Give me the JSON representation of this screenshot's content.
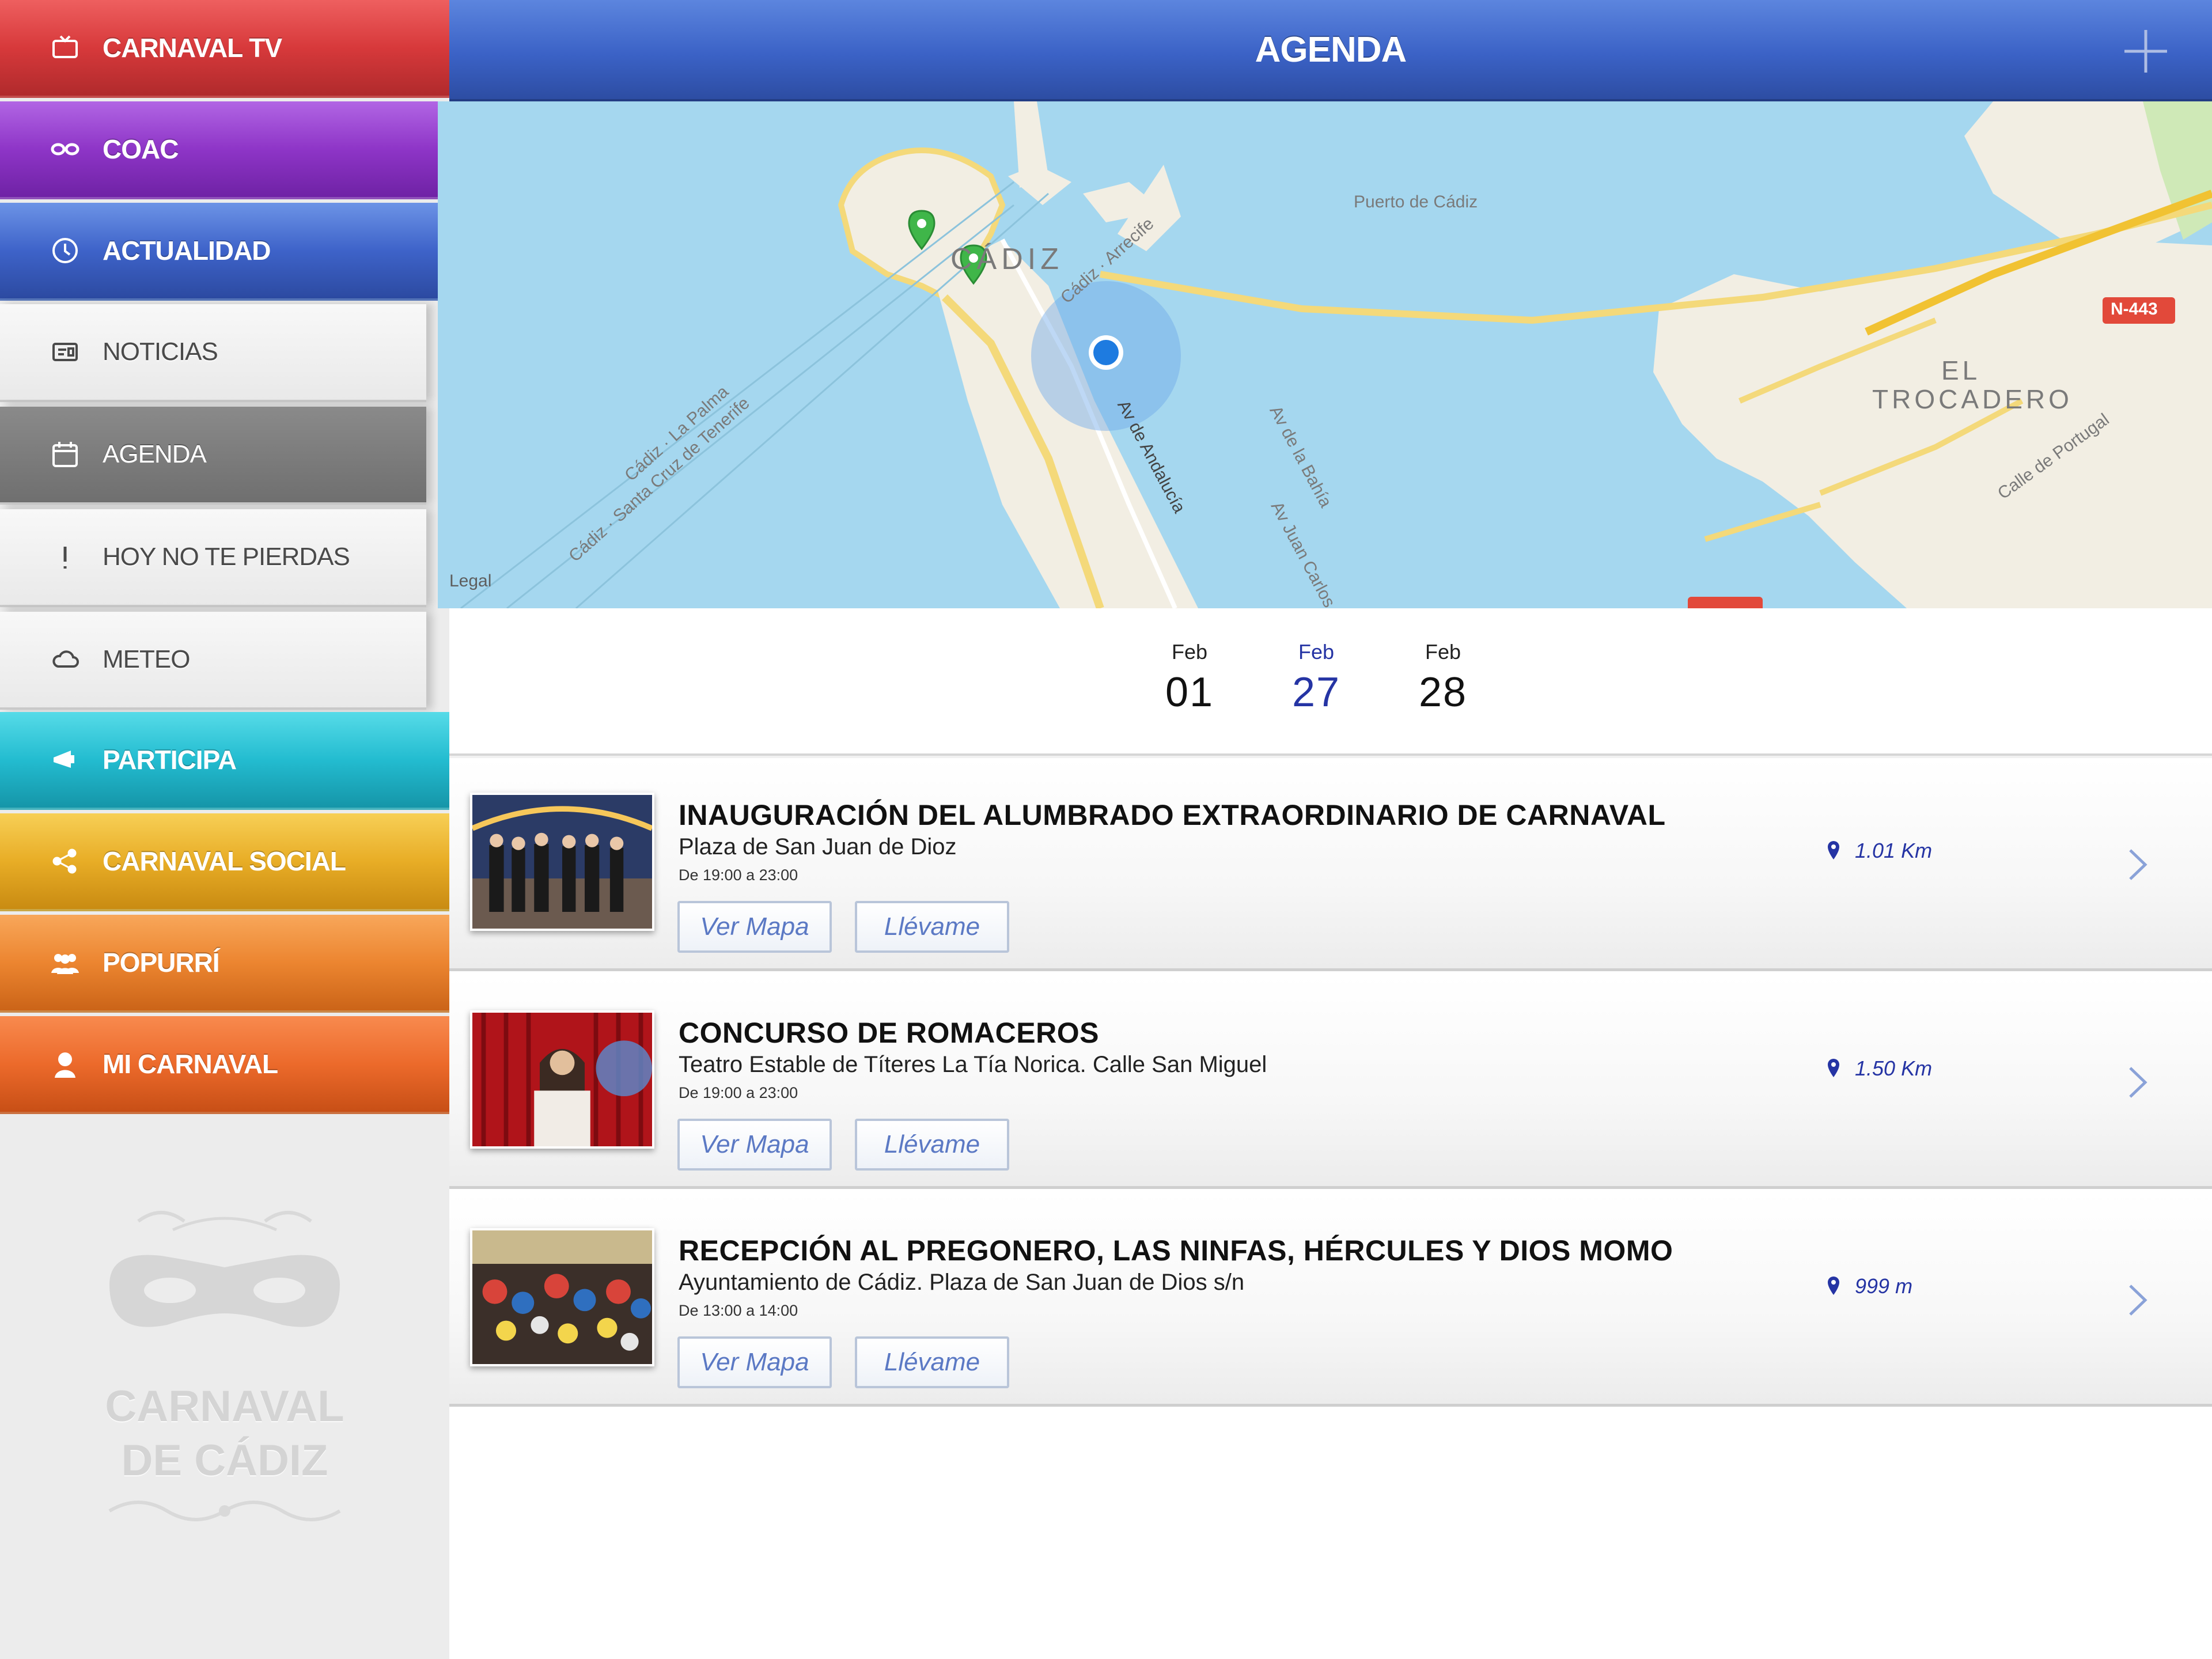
{
  "sidebar": {
    "items": [
      {
        "label": "CARNAVAL TV",
        "icon": "tv-icon",
        "color": "#d7393b"
      },
      {
        "label": "COAC",
        "icon": "mask-icon",
        "color": "#8e35c7"
      },
      {
        "label": "ACTUALIDAD",
        "icon": "clock-icon",
        "color": "#3e63c9"
      },
      {
        "label": "PARTICIPA",
        "icon": "megaphone-icon",
        "color": "#23bcd0"
      },
      {
        "label": "CARNAVAL SOCIAL",
        "icon": "share-icon",
        "color": "#e8ad26"
      },
      {
        "label": "POPURRÍ",
        "icon": "group-icon",
        "color": "#ec8530"
      },
      {
        "label": "MI CARNAVAL",
        "icon": "user-icon",
        "color": "#ec6a2b"
      }
    ],
    "subitems": [
      {
        "label": "NOTICIAS",
        "icon": "news-icon"
      },
      {
        "label": "AGENDA",
        "icon": "calendar-icon",
        "active": true
      },
      {
        "label": "HOY NO TE PIERDAS",
        "icon": "exclamation-icon"
      },
      {
        "label": "METEO",
        "icon": "cloud-icon"
      }
    ],
    "watermark": {
      "line1": "CARNAVAL",
      "line2": "DE CÁDIZ"
    }
  },
  "header": {
    "title": "AGENDA",
    "add_icon": "plus-icon"
  },
  "map": {
    "labels": {
      "puerto": "Puerto de Cádiz",
      "cadiz": "CÁDIZ",
      "trocadero_1": "EL",
      "trocadero_2": "TROCADERO",
      "road_n443": "N-443",
      "calle_portugal": "Calle de Portugal",
      "av_andalucia": "Av de Andalucía",
      "av_bahia": "Av de la Bahía",
      "av_juan": "Av Juan Carlos",
      "cadiz_arrecife": "Cádiz · Arrecife",
      "cadiz_palma": "Cádiz · La Palma",
      "cadiz_tenerife": "Cádiz · Santa Cruz de Tenerife",
      "road_n443b": "N-443"
    },
    "legal": "Legal"
  },
  "dates": [
    {
      "month": "Feb",
      "day": "01",
      "selected": false
    },
    {
      "month": "Feb",
      "day": "27",
      "selected": true
    },
    {
      "month": "Feb",
      "day": "28",
      "selected": false
    }
  ],
  "events": [
    {
      "title": "INAUGURACIÓN DEL ALUMBRADO EXTRAORDINARIO DE CARNAVAL",
      "place": "Plaza de San Juan de Dioz",
      "time": "De 19:00 a 23:00",
      "distance": "1.01 Km",
      "map_button": "Ver Mapa",
      "go_button": "Llévame"
    },
    {
      "title": "CONCURSO DE ROMACEROS",
      "place": "Teatro Estable de Títeres La Tía Norica. Calle San Miguel",
      "time": "De 19:00 a 23:00",
      "distance": "1.50 Km",
      "map_button": "Ver Mapa",
      "go_button": "Llévame"
    },
    {
      "title": "RECEPCIÓN AL PREGONERO, LAS NINFAS, HÉRCULES Y DIOS MOMO",
      "place": "Ayuntamiento de Cádiz. Plaza de San Juan de Dios s/n",
      "time": "De 13:00 a 14:00",
      "distance": "999 m",
      "map_button": "Ver Mapa",
      "go_button": "Llévame"
    }
  ],
  "colors": {
    "header": "#3b62c6",
    "accent_date": "#2534a4",
    "map_water": "#a4d6ee",
    "map_land": "#f2eee3",
    "road": "#f4d97a"
  }
}
